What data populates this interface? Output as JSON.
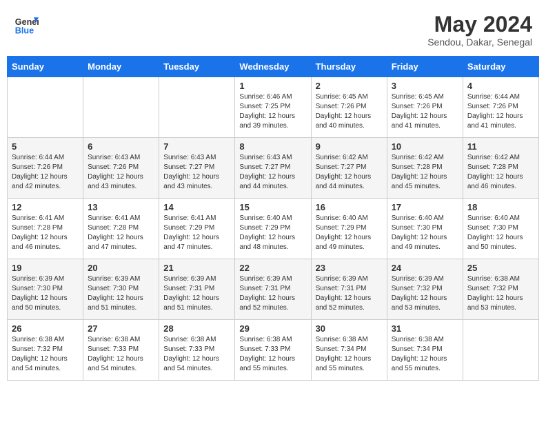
{
  "header": {
    "logo_line1": "General",
    "logo_line2": "Blue",
    "month_title": "May 2024",
    "subtitle": "Sendou, Dakar, Senegal"
  },
  "columns": [
    "Sunday",
    "Monday",
    "Tuesday",
    "Wednesday",
    "Thursday",
    "Friday",
    "Saturday"
  ],
  "weeks": [
    [
      {
        "day": "",
        "info": ""
      },
      {
        "day": "",
        "info": ""
      },
      {
        "day": "",
        "info": ""
      },
      {
        "day": "1",
        "info": "Sunrise: 6:46 AM\nSunset: 7:25 PM\nDaylight: 12 hours and 39 minutes."
      },
      {
        "day": "2",
        "info": "Sunrise: 6:45 AM\nSunset: 7:26 PM\nDaylight: 12 hours and 40 minutes."
      },
      {
        "day": "3",
        "info": "Sunrise: 6:45 AM\nSunset: 7:26 PM\nDaylight: 12 hours and 41 minutes."
      },
      {
        "day": "4",
        "info": "Sunrise: 6:44 AM\nSunset: 7:26 PM\nDaylight: 12 hours and 41 minutes."
      }
    ],
    [
      {
        "day": "5",
        "info": "Sunrise: 6:44 AM\nSunset: 7:26 PM\nDaylight: 12 hours and 42 minutes."
      },
      {
        "day": "6",
        "info": "Sunrise: 6:43 AM\nSunset: 7:26 PM\nDaylight: 12 hours and 43 minutes."
      },
      {
        "day": "7",
        "info": "Sunrise: 6:43 AM\nSunset: 7:27 PM\nDaylight: 12 hours and 43 minutes."
      },
      {
        "day": "8",
        "info": "Sunrise: 6:43 AM\nSunset: 7:27 PM\nDaylight: 12 hours and 44 minutes."
      },
      {
        "day": "9",
        "info": "Sunrise: 6:42 AM\nSunset: 7:27 PM\nDaylight: 12 hours and 44 minutes."
      },
      {
        "day": "10",
        "info": "Sunrise: 6:42 AM\nSunset: 7:28 PM\nDaylight: 12 hours and 45 minutes."
      },
      {
        "day": "11",
        "info": "Sunrise: 6:42 AM\nSunset: 7:28 PM\nDaylight: 12 hours and 46 minutes."
      }
    ],
    [
      {
        "day": "12",
        "info": "Sunrise: 6:41 AM\nSunset: 7:28 PM\nDaylight: 12 hours and 46 minutes."
      },
      {
        "day": "13",
        "info": "Sunrise: 6:41 AM\nSunset: 7:28 PM\nDaylight: 12 hours and 47 minutes."
      },
      {
        "day": "14",
        "info": "Sunrise: 6:41 AM\nSunset: 7:29 PM\nDaylight: 12 hours and 47 minutes."
      },
      {
        "day": "15",
        "info": "Sunrise: 6:40 AM\nSunset: 7:29 PM\nDaylight: 12 hours and 48 minutes."
      },
      {
        "day": "16",
        "info": "Sunrise: 6:40 AM\nSunset: 7:29 PM\nDaylight: 12 hours and 49 minutes."
      },
      {
        "day": "17",
        "info": "Sunrise: 6:40 AM\nSunset: 7:30 PM\nDaylight: 12 hours and 49 minutes."
      },
      {
        "day": "18",
        "info": "Sunrise: 6:40 AM\nSunset: 7:30 PM\nDaylight: 12 hours and 50 minutes."
      }
    ],
    [
      {
        "day": "19",
        "info": "Sunrise: 6:39 AM\nSunset: 7:30 PM\nDaylight: 12 hours and 50 minutes."
      },
      {
        "day": "20",
        "info": "Sunrise: 6:39 AM\nSunset: 7:30 PM\nDaylight: 12 hours and 51 minutes."
      },
      {
        "day": "21",
        "info": "Sunrise: 6:39 AM\nSunset: 7:31 PM\nDaylight: 12 hours and 51 minutes."
      },
      {
        "day": "22",
        "info": "Sunrise: 6:39 AM\nSunset: 7:31 PM\nDaylight: 12 hours and 52 minutes."
      },
      {
        "day": "23",
        "info": "Sunrise: 6:39 AM\nSunset: 7:31 PM\nDaylight: 12 hours and 52 minutes."
      },
      {
        "day": "24",
        "info": "Sunrise: 6:39 AM\nSunset: 7:32 PM\nDaylight: 12 hours and 53 minutes."
      },
      {
        "day": "25",
        "info": "Sunrise: 6:38 AM\nSunset: 7:32 PM\nDaylight: 12 hours and 53 minutes."
      }
    ],
    [
      {
        "day": "26",
        "info": "Sunrise: 6:38 AM\nSunset: 7:32 PM\nDaylight: 12 hours and 54 minutes."
      },
      {
        "day": "27",
        "info": "Sunrise: 6:38 AM\nSunset: 7:33 PM\nDaylight: 12 hours and 54 minutes."
      },
      {
        "day": "28",
        "info": "Sunrise: 6:38 AM\nSunset: 7:33 PM\nDaylight: 12 hours and 54 minutes."
      },
      {
        "day": "29",
        "info": "Sunrise: 6:38 AM\nSunset: 7:33 PM\nDaylight: 12 hours and 55 minutes."
      },
      {
        "day": "30",
        "info": "Sunrise: 6:38 AM\nSunset: 7:34 PM\nDaylight: 12 hours and 55 minutes."
      },
      {
        "day": "31",
        "info": "Sunrise: 6:38 AM\nSunset: 7:34 PM\nDaylight: 12 hours and 55 minutes."
      },
      {
        "day": "",
        "info": ""
      }
    ]
  ]
}
